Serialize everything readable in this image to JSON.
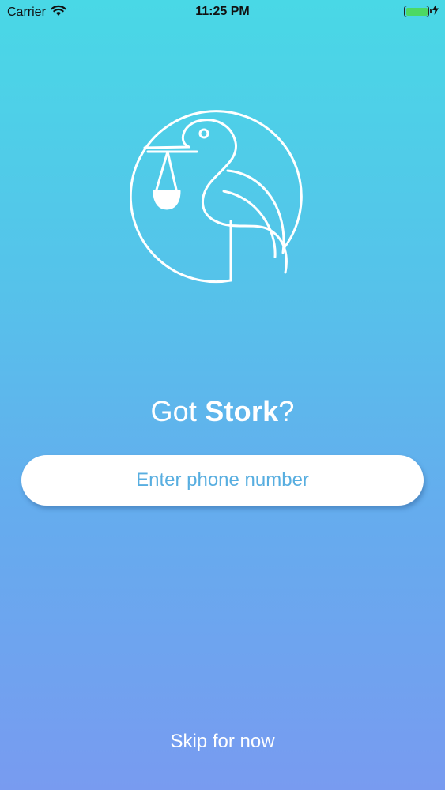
{
  "status_bar": {
    "carrier": "Carrier",
    "time": "11:25 PM",
    "battery_level": 1.0,
    "battery_color": "#4cd964",
    "charging": true,
    "icons": [
      "wifi-icon",
      "battery-icon",
      "charging-bolt-icon"
    ]
  },
  "logo": {
    "icon": "stork-logo-icon"
  },
  "headline": {
    "prefix": "Got ",
    "brand": "Stork",
    "suffix": "?"
  },
  "phone_input": {
    "placeholder": "Enter phone number",
    "value": ""
  },
  "skip": {
    "label": "Skip for now"
  },
  "colors": {
    "gradient_top": "#49d8e6",
    "gradient_bottom": "#789bf0",
    "placeholder_text": "#58aee0",
    "foreground": "#ffffff"
  }
}
